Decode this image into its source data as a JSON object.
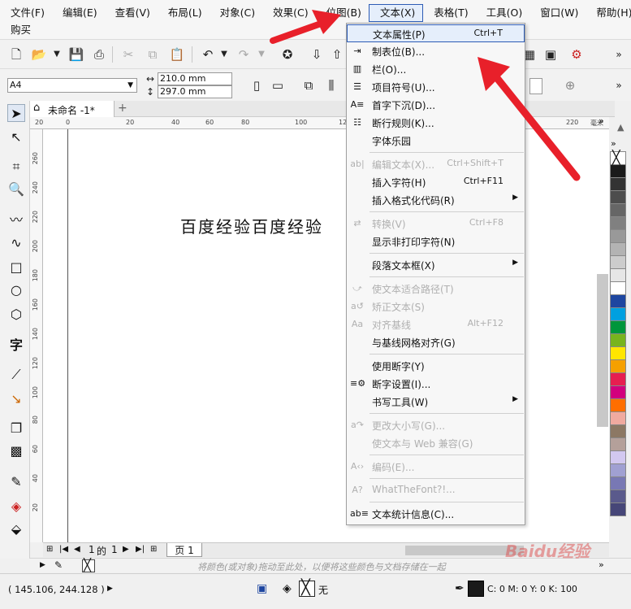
{
  "menubar": {
    "items": [
      "文件(F)",
      "编辑(E)",
      "查看(V)",
      "布局(L)",
      "对象(C)",
      "效果(C)",
      "位图(B)",
      "文本(X)",
      "表格(T)",
      "工具(O)",
      "窗口(W)",
      "帮助(H)"
    ],
    "second_row": "购买"
  },
  "property_bar": {
    "page_size": "A4",
    "width": "210.0 mm",
    "height": "297.0 mm"
  },
  "document_tab": {
    "title": "未命名 -1*",
    "add_symbol": "+"
  },
  "ruler": {
    "h_ticks": [
      "20",
      "0",
      "20",
      "40",
      "60",
      "80",
      "100",
      "12",
      "220",
      "毫米"
    ],
    "v_ticks": [
      "260",
      "240",
      "220",
      "200",
      "180",
      "160",
      "140",
      "120",
      "100",
      "80",
      "60",
      "40",
      "20"
    ]
  },
  "canvas": {
    "text": "百度经验百度经验"
  },
  "page_nav": {
    "current": "1",
    "of": "的",
    "total": "1",
    "tab": "页 1"
  },
  "color_bar": {
    "hint": "将颜色(或对象)拖动至此处，以便将这些颜色与文档存储在一起"
  },
  "status": {
    "coords": "( 145.106, 244.128 )",
    "fill_none": "无",
    "cmyk": "C: 0 M: 0 Y: 0 K: 100",
    "watermark": "Baidu经验"
  },
  "text_menu": {
    "items": [
      {
        "label": "文本属性(P)",
        "shortcut": "Ctrl+T",
        "icon": "",
        "disabled": false,
        "submenu": false,
        "highlighted": true
      },
      {
        "label": "制表位(B)...",
        "shortcut": "",
        "icon": "tabs-icon",
        "disabled": false,
        "submenu": false
      },
      {
        "label": "栏(O)...",
        "shortcut": "",
        "icon": "columns-icon",
        "disabled": false,
        "submenu": false
      },
      {
        "label": "项目符号(U)...",
        "shortcut": "",
        "icon": "bullets-icon",
        "disabled": false,
        "submenu": false
      },
      {
        "label": "首字下沉(D)...",
        "shortcut": "",
        "icon": "dropcap-icon",
        "disabled": false,
        "submenu": false
      },
      {
        "label": "断行规则(K)...",
        "shortcut": "",
        "icon": "linebreak-icon",
        "disabled": false,
        "submenu": false
      },
      {
        "label": "字体乐园",
        "shortcut": "",
        "icon": "",
        "disabled": false,
        "submenu": false
      },
      {
        "label": "编辑文本(X)...",
        "shortcut": "Ctrl+Shift+T",
        "icon": "ab-icon",
        "disabled": true,
        "submenu": false
      },
      {
        "label": "插入字符(H)",
        "shortcut": "Ctrl+F11",
        "icon": "",
        "disabled": false,
        "submenu": false
      },
      {
        "label": "插入格式化代码(R)",
        "shortcut": "",
        "icon": "",
        "disabled": false,
        "submenu": true
      },
      {
        "label": "转换(V)",
        "shortcut": "Ctrl+F8",
        "icon": "convert-icon",
        "disabled": true,
        "submenu": false
      },
      {
        "label": "显示非打印字符(N)",
        "shortcut": "",
        "icon": "",
        "disabled": false,
        "submenu": false
      },
      {
        "label": "段落文本框(X)",
        "shortcut": "",
        "icon": "",
        "disabled": false,
        "submenu": true
      },
      {
        "label": "使文本适合路径(T)",
        "shortcut": "",
        "icon": "fit-path-icon",
        "disabled": true,
        "submenu": false
      },
      {
        "label": "矫正文本(S)",
        "shortcut": "",
        "icon": "straighten-icon",
        "disabled": true,
        "submenu": false
      },
      {
        "label": "对齐基线",
        "shortcut": "Alt+F12",
        "icon": "baseline-icon",
        "disabled": true,
        "submenu": false
      },
      {
        "label": "与基线网格对齐(G)",
        "shortcut": "",
        "icon": "",
        "disabled": false,
        "submenu": false
      },
      {
        "label": "使用断字(Y)",
        "shortcut": "",
        "icon": "",
        "disabled": false,
        "submenu": false
      },
      {
        "label": "断字设置(I)...",
        "shortcut": "",
        "icon": "hyphen-icon",
        "disabled": false,
        "submenu": false
      },
      {
        "label": "书写工具(W)",
        "shortcut": "",
        "icon": "",
        "disabled": false,
        "submenu": true
      },
      {
        "label": "更改大小写(G)...",
        "shortcut": "",
        "icon": "case-icon",
        "disabled": true,
        "submenu": false
      },
      {
        "label": "使文本与 Web 兼容(G)",
        "shortcut": "",
        "icon": "",
        "disabled": true,
        "submenu": false
      },
      {
        "label": "编码(E)...",
        "shortcut": "",
        "icon": "encode-icon",
        "disabled": true,
        "submenu": false
      },
      {
        "label": "WhatTheFont?!...",
        "shortcut": "",
        "icon": "wtf-icon",
        "disabled": true,
        "submenu": false
      },
      {
        "label": "文本统计信息(C)...",
        "shortcut": "",
        "icon": "stats-icon",
        "disabled": false,
        "submenu": false
      }
    ]
  },
  "colors": {
    "accent": "#2d5cb5",
    "arrow": "#e8202a",
    "palette": [
      "#ffffff",
      "#1a1a1a",
      "#333333",
      "#4d4d4d",
      "#666666",
      "#808080",
      "#999999",
      "#b3b3b3",
      "#cccccc",
      "#e6e6e6",
      "#ffffff",
      "#1e46a0",
      "#00a0e0",
      "#00963c",
      "#78b41e",
      "#ffe600",
      "#f5a000",
      "#e61e50",
      "#d2007d",
      "#ff6e00",
      "#f0aaa0",
      "#8c7864",
      "#b4a09a",
      "#d2c8f0",
      "#a0a0d2",
      "#7878b4",
      "#5a5a8c",
      "#464678"
    ]
  }
}
